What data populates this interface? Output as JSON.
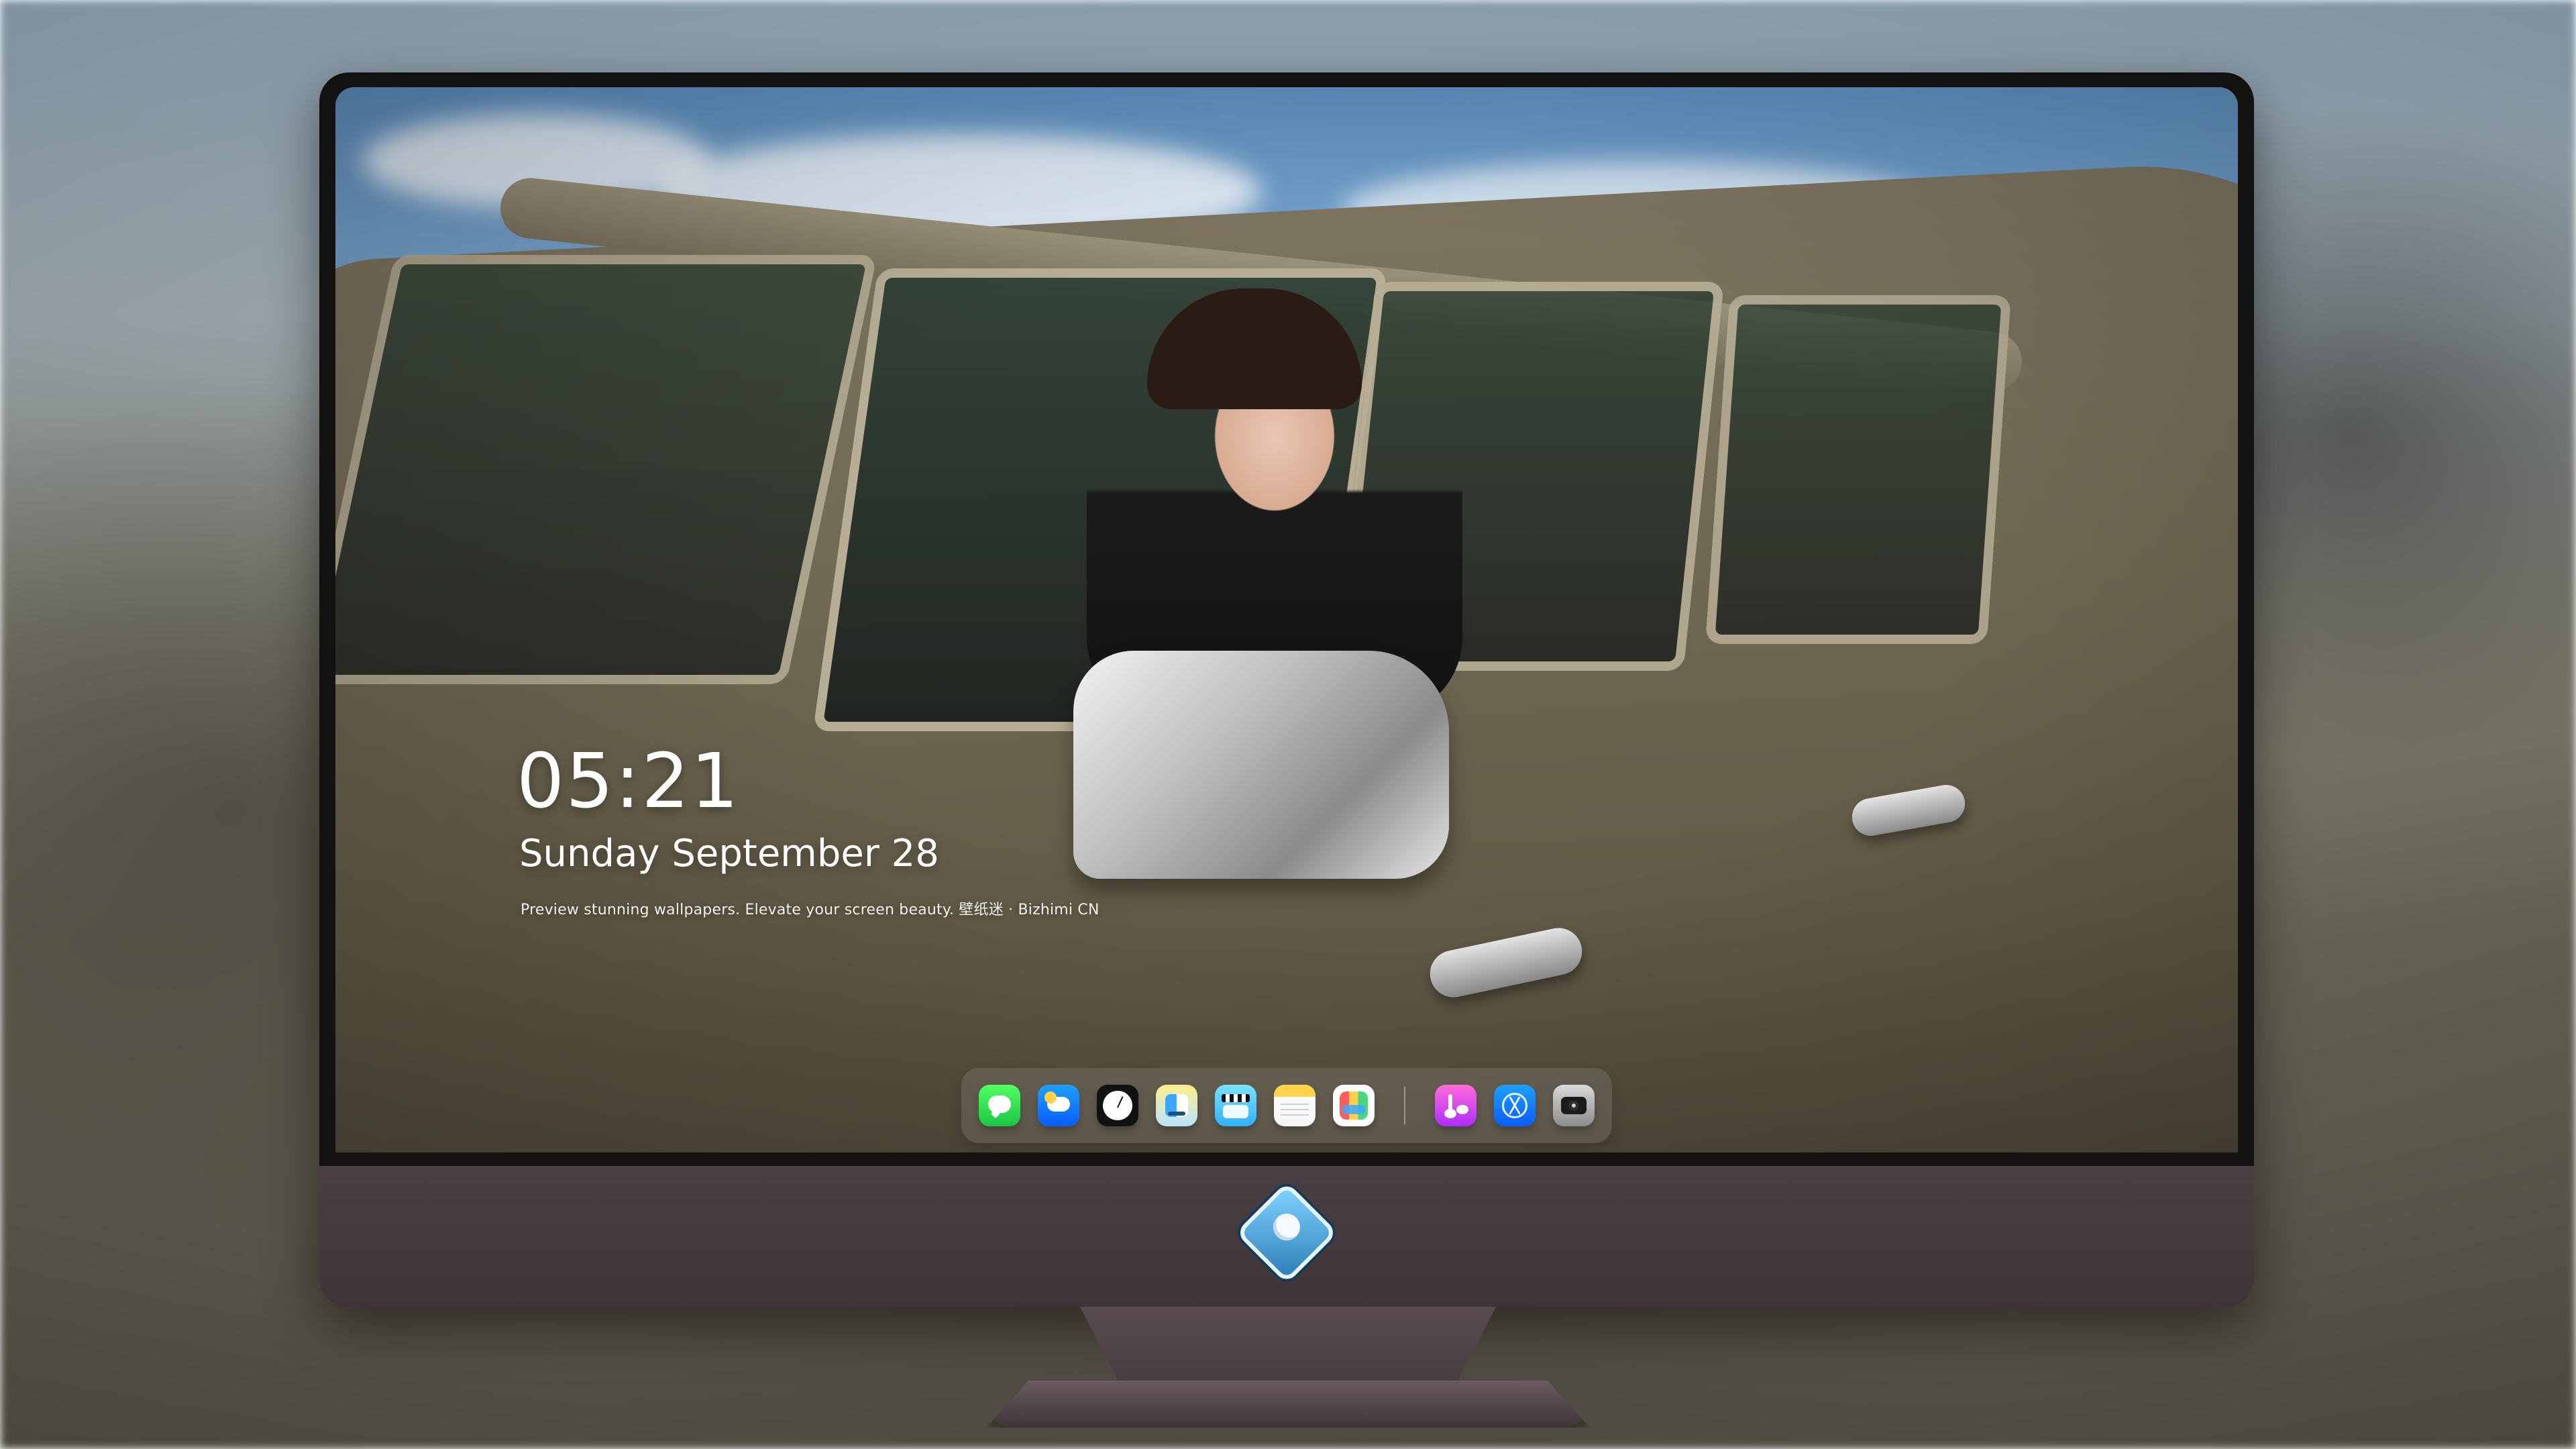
{
  "desktop": {
    "clock": {
      "time": "05:21",
      "date": "Sunday September  28",
      "tagline": "Preview stunning wallpapers. Elevate your screen beauty. 壁纸迷 · Bizhimi CN"
    },
    "dock": {
      "apps": [
        {
          "icon": "messages-icon"
        },
        {
          "icon": "weather-icon"
        },
        {
          "icon": "clock-icon"
        },
        {
          "icon": "finder-icon"
        },
        {
          "icon": "clips-icon"
        },
        {
          "icon": "notes-icon"
        },
        {
          "icon": "photos-icon"
        },
        {
          "icon": "music-icon"
        },
        {
          "icon": "app-store-icon"
        },
        {
          "icon": "camera-icon"
        }
      ]
    },
    "monitor": {
      "logo_icon": "brand-logo-icon"
    },
    "colors": {
      "chin": "#4a3f43",
      "clock_text": "#ffffff",
      "dock_bg": "rgba(255,255,255,0.10)"
    }
  }
}
